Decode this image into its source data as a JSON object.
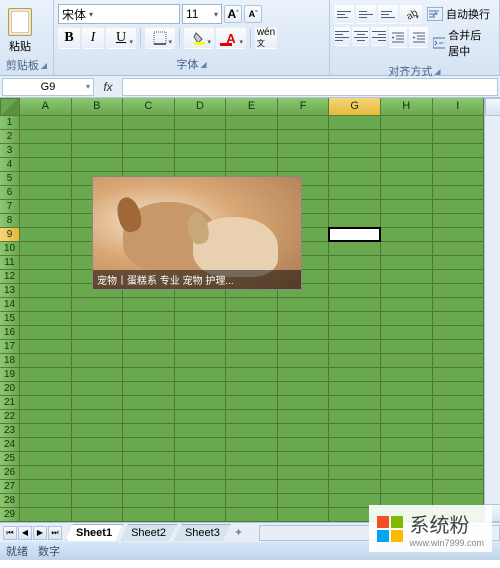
{
  "ribbon": {
    "clipboard": {
      "paste_label": "粘贴",
      "section_label": "剪贴板"
    },
    "font": {
      "name": "宋体",
      "size": "11",
      "section_label": "字体"
    },
    "alignment": {
      "wrap_text": "自动换行",
      "merge_center": "合并后居中",
      "section_label": "对齐方式"
    }
  },
  "formula_bar": {
    "name_box": "G9",
    "fx_label": "fx"
  },
  "columns": [
    "A",
    "B",
    "C",
    "D",
    "E",
    "F",
    "G",
    "H",
    "I"
  ],
  "rows_count": 32,
  "selected_cell": {
    "col": "G",
    "row": 9,
    "col_index": 6,
    "row_index": 8
  },
  "embedded_image": {
    "caption": "宠物丨蛋糕系 专业 宠物 护理..."
  },
  "sheet_tabs": [
    "Sheet1",
    "Sheet2",
    "Sheet3"
  ],
  "active_tab": 0,
  "status_bar": {
    "ready": "就绪",
    "ime": "数字"
  },
  "watermark": {
    "brand": "系统粉",
    "url": "www.win7999.com"
  },
  "ms_colors": [
    "#f25022",
    "#7fba00",
    "#00a4ef",
    "#ffb900"
  ]
}
